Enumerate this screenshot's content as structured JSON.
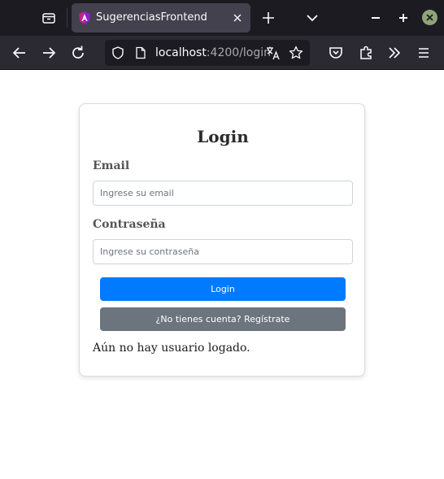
{
  "browser": {
    "tab": {
      "title": "SugerenciasFrontend"
    },
    "url": {
      "host": "localhost",
      "rest": ":4200/login"
    },
    "icons": {
      "tab_list": "tab-list-icon",
      "favicon": "angular-favicon-icon",
      "tab_close": "close-icon",
      "new_tab": "plus-icon",
      "tabs_menu": "chevron-down-icon",
      "window_minimize": "minimize-icon",
      "window_maximize": "maximize-icon",
      "window_close": "close-icon",
      "back": "arrow-left-icon",
      "forward": "arrow-right-icon",
      "reload": "reload-icon",
      "tracking_protection": "shield-icon",
      "page_info": "page-icon",
      "translate": "translate-icon",
      "bookmark": "star-icon",
      "pocket": "pocket-icon",
      "extensions": "puzzle-icon",
      "overflow": "double-chevron-right-icon",
      "menu": "hamburger-icon"
    }
  },
  "login": {
    "title": "Login",
    "email": {
      "label": "Email",
      "value": "",
      "placeholder": "Ingrese su email"
    },
    "password": {
      "label": "Contraseña",
      "value": "",
      "placeholder": "Ingrese su contraseña"
    },
    "login_button": "Login",
    "register_button": "¿No tienes cuenta? Regístrate",
    "status": "Aún no hay usuario logado."
  },
  "colors": {
    "primary": "#007bff",
    "secondary": "#6c757d",
    "chrome_dark": "#1c1b22",
    "toolbar": "#2b2a33"
  }
}
